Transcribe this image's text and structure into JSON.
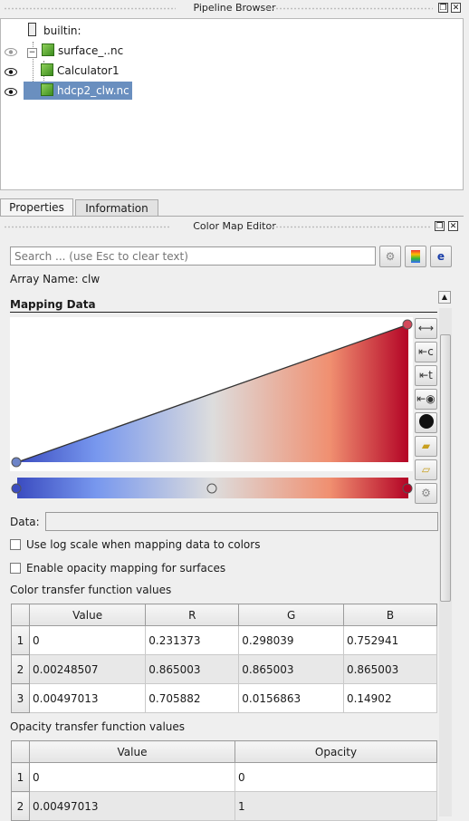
{
  "pipeline_browser": {
    "title": "Pipeline Browser",
    "items": [
      {
        "label": "builtin:"
      },
      {
        "label": "surface_..nc"
      },
      {
        "label": "Calculator1"
      },
      {
        "label": "hdcp2_clw.nc"
      }
    ]
  },
  "tabs": [
    {
      "label": "Properties",
      "active": true
    },
    {
      "label": "Information",
      "active": false
    }
  ],
  "color_map_editor": {
    "title": "Color Map Editor",
    "search_placeholder": "Search ... (use Esc to clear text)",
    "array_name": "Array Name: clw",
    "section_title": "Mapping Data",
    "data_label": "Data:",
    "data_value": "",
    "log_scale_label": "Use log scale when mapping data to colors",
    "log_scale_checked": false,
    "opacity_mapping_label": "Enable opacity mapping for surfaces",
    "opacity_mapping_checked": false,
    "colormap_colors": {
      "low": "#3b4cc0",
      "mid": "#dddddd",
      "high": "#b40426"
    }
  },
  "color_table": {
    "title": "Color transfer function values",
    "headers": [
      "Value",
      "R",
      "G",
      "B"
    ],
    "rows": [
      {
        "index": "1",
        "cells": [
          "0",
          "0.231373",
          "0.298039",
          "0.752941"
        ]
      },
      {
        "index": "2",
        "cells": [
          "0.00248507",
          "0.865003",
          "0.865003",
          "0.865003"
        ]
      },
      {
        "index": "3",
        "cells": [
          "0.00497013",
          "0.705882",
          "0.0156863",
          "0.14902"
        ]
      }
    ]
  },
  "opacity_table": {
    "title": "Opacity transfer function values",
    "headers": [
      "Value",
      "Opacity"
    ],
    "rows": [
      {
        "index": "1",
        "cells": [
          "0",
          "0"
        ]
      },
      {
        "index": "2",
        "cells": [
          "0.00497013",
          "1"
        ]
      }
    ]
  }
}
